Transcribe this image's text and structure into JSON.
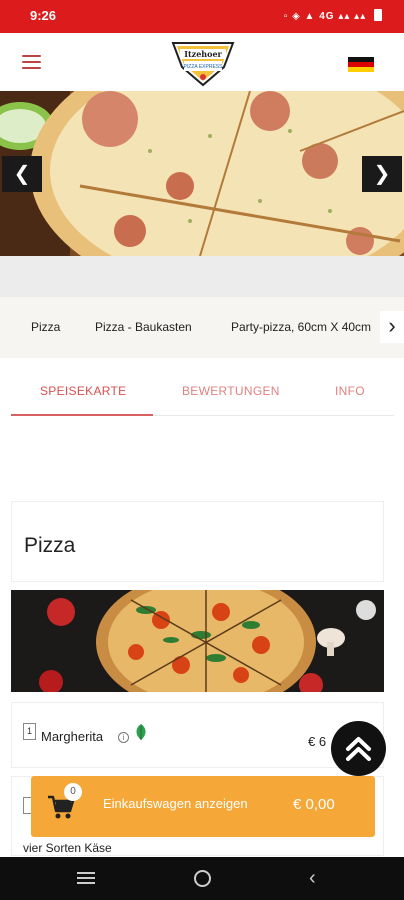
{
  "status_bar": {
    "time": "9:26",
    "network": "4G"
  },
  "header": {
    "logo_text_top": "Itzehoer",
    "logo_text_bottom": "PIZZA EXPRESS"
  },
  "categories": [
    {
      "label": "Pizza"
    },
    {
      "label": "Pizza - Baukasten"
    },
    {
      "label": "Party-pizza, 60cm X 40cm"
    }
  ],
  "tabs": [
    {
      "label": "SPEISEKARTE",
      "active": true
    },
    {
      "label": "BEWERTUNGEN",
      "active": false
    },
    {
      "label": "INFO",
      "active": false
    }
  ],
  "section": {
    "title": "Pizza"
  },
  "items": [
    {
      "number": "1",
      "name": "Margherita",
      "price": "€ 6"
    },
    {
      "description": "vier Sorten Käse"
    }
  ],
  "cart": {
    "count": "0",
    "label": "Einkaufswagen anzeigen",
    "total": "€ 0,00"
  },
  "colors": {
    "status_bar": "#dc1c1c",
    "accent": "#d64f4f",
    "cart_bar": "#f5a838",
    "nav_bar": "#0e0e0e"
  },
  "icons": {
    "menu": "hamburger-icon",
    "language": "german-flag-icon",
    "carousel_prev": "chevron-left-icon",
    "carousel_next": "chevron-right-icon",
    "category_next": "chevron-right-icon",
    "info": "info-icon",
    "vegetarian": "leaf-icon",
    "scroll_top": "double-chevron-up-icon",
    "cart": "cart-icon"
  }
}
